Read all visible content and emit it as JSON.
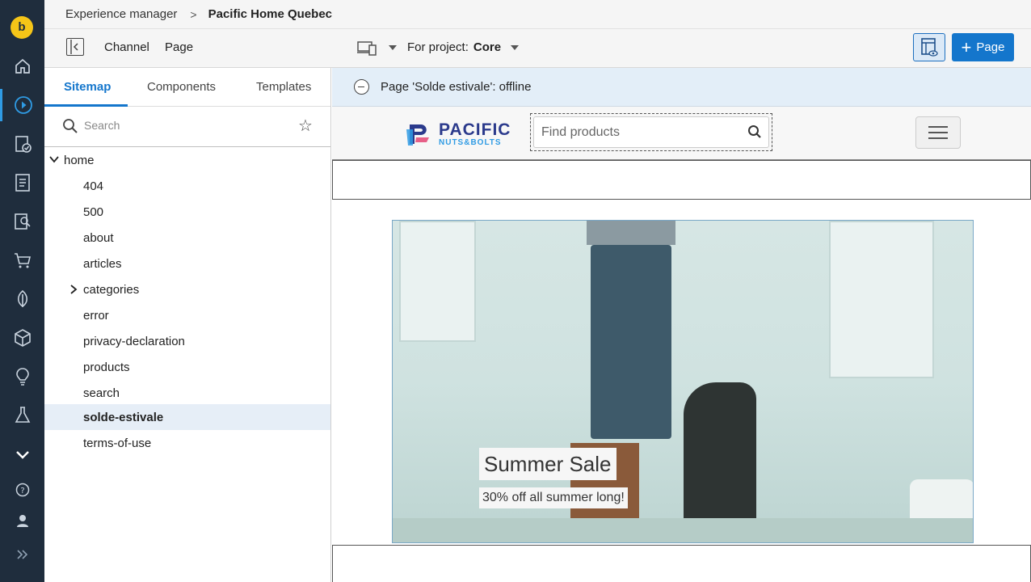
{
  "nav": {
    "logo_letter": "b",
    "items": [
      "home-icon",
      "experience-icon",
      "tasks-icon",
      "documents-icon",
      "search-report-icon",
      "cart-icon",
      "leaf-icon",
      "box-icon",
      "lightbulb-icon",
      "flask-icon",
      "more-icon",
      "help-icon",
      "user-icon",
      "expand-icon"
    ]
  },
  "breadcrumb": {
    "parent": "Experience manager",
    "separator": ">",
    "current": "Pacific Home Quebec"
  },
  "toolbar": {
    "channel_label": "Channel",
    "page_label": "Page",
    "project_label": "For project:",
    "project_value": "Core",
    "add_page_label": "Page"
  },
  "sidebar": {
    "tabs": [
      "Sitemap",
      "Components",
      "Templates"
    ],
    "search_placeholder": "Search",
    "tree": {
      "root": "home",
      "children": [
        "404",
        "500",
        "about",
        "articles",
        "categories",
        "error",
        "privacy-declaration",
        "products",
        "search",
        "solde-estivale",
        "terms-of-use"
      ],
      "selected": "solde-estivale"
    }
  },
  "main": {
    "status_text": "Page 'Solde estivale': offline",
    "brand_primary": "PACIFIC",
    "brand_secondary": "NUTS&BOLTS",
    "find_placeholder": "Find products",
    "hero_title": "Summer Sale",
    "hero_subtitle": "30% off all summer long!"
  },
  "colors": {
    "nav_bg": "#1f2d3d",
    "accent": "#1476cc",
    "status_bg": "#e3eef8",
    "logo": "#f5c518"
  }
}
